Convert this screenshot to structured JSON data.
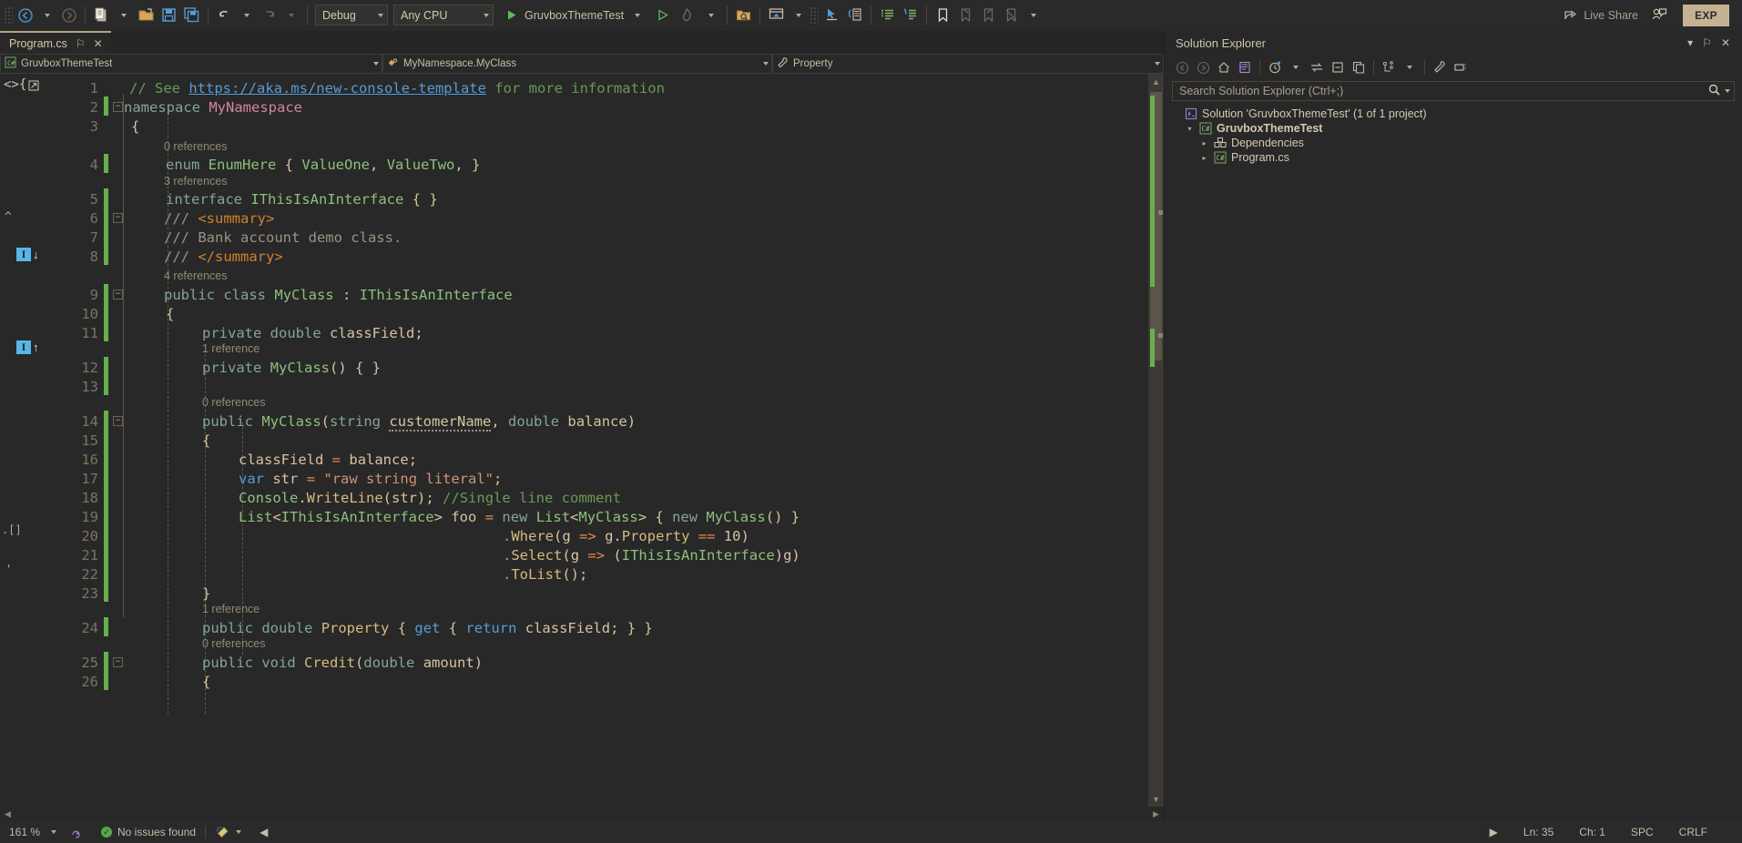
{
  "toolbar": {
    "nav_back": "navigate-back",
    "nav_forward": "navigate-forward",
    "new_project": "new-project",
    "open_file": "open-file",
    "save": "save",
    "save_all": "save-all",
    "undo": "undo",
    "redo": "redo",
    "config_value": "Debug",
    "platform_value": "Any CPU",
    "start_label": "GruvboxThemeTest",
    "hot_reload": "hot-reload",
    "live_share_label": "Live Share",
    "feedback": "send-feedback",
    "exp_badge": "EXP"
  },
  "tab": {
    "title": "Program.cs",
    "pin": "⚐",
    "close": "✕"
  },
  "navbar": {
    "project": "GruvboxThemeTest",
    "type": "MyNamespace.MyClass",
    "member": "Property"
  },
  "editor": {
    "lines": [
      {
        "n": "1",
        "bar": false,
        "fold": false,
        "lens": null,
        "indent": 0
      },
      {
        "n": "2",
        "bar": true,
        "fold": true,
        "lens": null,
        "indent": 0
      },
      {
        "n": "3",
        "bar": false,
        "fold": false,
        "lens": null,
        "indent": 1
      },
      {
        "n": "4",
        "bar": true,
        "fold": false,
        "lens": "0 references",
        "indent": 2
      },
      {
        "n": "5",
        "bar": true,
        "fold": false,
        "lens": "3 references",
        "indent": 2
      },
      {
        "n": "6",
        "bar": true,
        "fold": true,
        "lens": null,
        "indent": 2
      },
      {
        "n": "7",
        "bar": true,
        "fold": false,
        "lens": null,
        "indent": 2
      },
      {
        "n": "8",
        "bar": true,
        "fold": false,
        "lens": null,
        "indent": 2
      },
      {
        "n": "9",
        "bar": true,
        "fold": true,
        "lens": "4 references",
        "indent": 2
      },
      {
        "n": "10",
        "bar": true,
        "fold": false,
        "lens": null,
        "indent": 2
      },
      {
        "n": "11",
        "bar": true,
        "fold": false,
        "lens": null,
        "indent": 3
      },
      {
        "n": "12",
        "bar": true,
        "fold": false,
        "lens": "1 reference",
        "indent": 3
      },
      {
        "n": "13",
        "bar": true,
        "fold": false,
        "lens": null,
        "indent": 3
      },
      {
        "n": "14",
        "bar": true,
        "fold": true,
        "lens": "0 references",
        "indent": 3
      },
      {
        "n": "15",
        "bar": true,
        "fold": false,
        "lens": null,
        "indent": 3
      },
      {
        "n": "16",
        "bar": true,
        "fold": false,
        "lens": null,
        "indent": 4
      },
      {
        "n": "17",
        "bar": true,
        "fold": false,
        "lens": null,
        "indent": 4
      },
      {
        "n": "18",
        "bar": true,
        "fold": false,
        "lens": null,
        "indent": 4
      },
      {
        "n": "19",
        "bar": true,
        "fold": false,
        "lens": null,
        "indent": 4
      },
      {
        "n": "20",
        "bar": true,
        "fold": false,
        "lens": null,
        "indent": 4
      },
      {
        "n": "21",
        "bar": true,
        "fold": false,
        "lens": null,
        "indent": 4
      },
      {
        "n": "22",
        "bar": true,
        "fold": false,
        "lens": null,
        "indent": 4
      },
      {
        "n": "23",
        "bar": true,
        "fold": false,
        "lens": null,
        "indent": 3
      },
      {
        "n": "24",
        "bar": true,
        "fold": false,
        "lens": "1 reference",
        "indent": 3
      },
      {
        "n": "25",
        "bar": true,
        "fold": true,
        "lens": "0 references",
        "indent": 3
      },
      {
        "n": "26",
        "bar": true,
        "fold": false,
        "lens": null,
        "indent": 3
      }
    ],
    "code_text": [
      "// See https://aka.ms/new-console-template for more information",
      "namespace MyNamespace",
      "{",
      "    enum EnumHere { ValueOne, ValueTwo, }",
      "    interface IThisIsAnInterface { }",
      "    /// <summary>",
      "    /// Bank account demo class.",
      "    /// </summary>",
      "    public class MyClass : IThisIsAnInterface",
      "    {",
      "        private double classField;",
      "        private MyClass() { }",
      "",
      "        public MyClass(string customerName, double balance)",
      "        {",
      "            classField = balance;",
      "            var str = \"raw string literal\";",
      "            Console.WriteLine(str); //Single line comment",
      "            List<IThisIsAnInterface> foo = new List<MyClass> { new MyClass() }",
      "                            .Where(g => g.Property == 10)",
      "                            .Select(g => (IThisIsAnInterface)g)",
      "                            .ToList();",
      "        }",
      "        public double Property { get { return classField; } }",
      "        public void Credit(double amount)",
      "        {"
    ],
    "glyphs": [
      {
        "name": "collapse-chevron",
        "symbol": "^"
      },
      {
        "name": "inheritance-down",
        "symbol": "↓"
      },
      {
        "name": "inheritance-up",
        "symbol": "↑"
      }
    ],
    "url": "https://aka.ms/new-console-template"
  },
  "solution_explorer": {
    "title": "Solution Explorer",
    "dropdown": "▾",
    "pin": "⚐",
    "close": "✕",
    "search_placeholder": "Search Solution Explorer (Ctrl+;)",
    "tools": [
      "back-icon",
      "forward-icon",
      "home-icon",
      "switch-views-icon",
      "pending-changes-icon",
      "sync-with-active-document-icon",
      "collapse-all-icon",
      "show-all-files-icon",
      "properties-hierarchy-icon",
      "properties-icon",
      "preview-selected-items-icon"
    ],
    "tree": [
      {
        "depth": 0,
        "twisty": "",
        "icon": "solution-icon",
        "label": "Solution 'GruvboxThemeTest' (1 of 1 project)",
        "bold": false
      },
      {
        "depth": 1,
        "twisty": "▾",
        "icon": "csproj-icon",
        "label": "GruvboxThemeTest",
        "bold": true
      },
      {
        "depth": 2,
        "twisty": "▸",
        "icon": "dependencies-icon",
        "label": "Dependencies",
        "bold": false
      },
      {
        "depth": 2,
        "twisty": "▸",
        "icon": "csfile-icon",
        "label": "Program.cs",
        "bold": false
      }
    ]
  },
  "status_bar": {
    "zoom": "161 %",
    "accessibility_icon": "accessibility-icon",
    "issues": "No issues found",
    "cleanup_icon": "code-cleanup-icon",
    "line": "Ln: 35",
    "char": "Ch: 1",
    "spaces": "SPC",
    "eol": "CRLF"
  },
  "colors": {
    "background": "#282828",
    "accent": "#b6a284",
    "change_bar": "#67b04f",
    "string": "#ce9178",
    "comment": "#6a9955",
    "keyword": "#83a598",
    "type": "#8ec07c",
    "namespace": "#d3869b",
    "method": "#d7ba7d",
    "exp_badge": "#c4b293"
  }
}
